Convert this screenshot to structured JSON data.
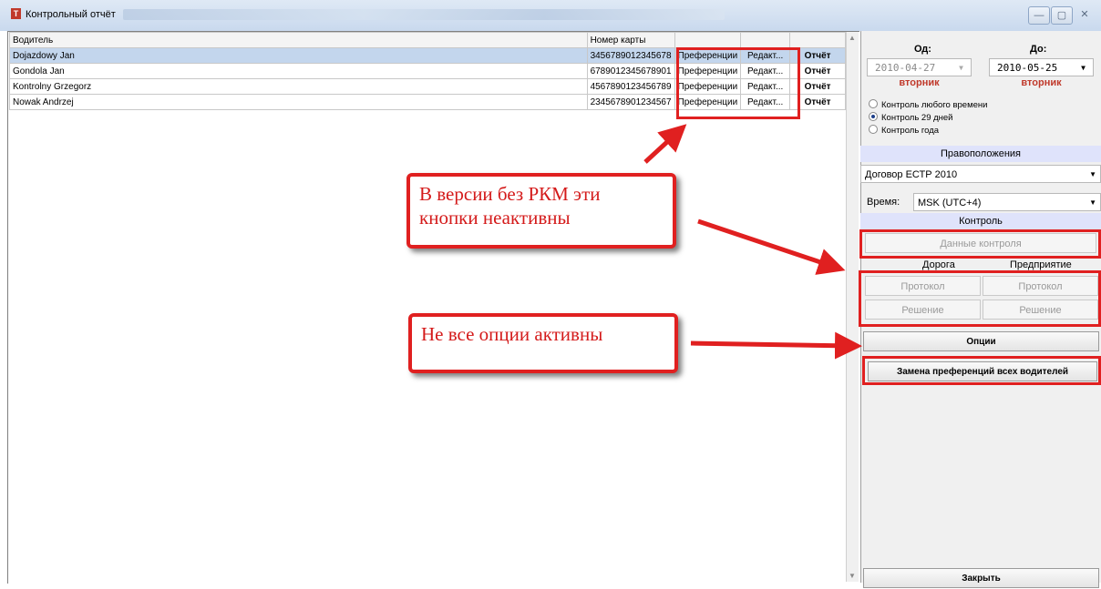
{
  "window": {
    "title": "Контрольный отчёт",
    "controls": [
      "—",
      "▢",
      "✕"
    ]
  },
  "table": {
    "headers": {
      "driver": "Водитель",
      "card": "Номер карты"
    },
    "rows": [
      {
        "driver": "Dojazdowy Jan",
        "card": "3456789012345678",
        "pref": "Преференции",
        "edit": "Редакт...",
        "report": "Отчёт"
      },
      {
        "driver": "Gondola Jan",
        "card": "6789012345678901",
        "pref": "Преференции",
        "edit": "Редакт...",
        "report": "Отчёт"
      },
      {
        "driver": "Kontrolny Grzegorz",
        "card": "4567890123456789",
        "pref": "Преференции",
        "edit": "Редакт...",
        "report": "Отчёт"
      },
      {
        "driver": "Nowak Andrzej",
        "card": "2345678901234567",
        "pref": "Преференции",
        "edit": "Редакт...",
        "report": "Отчёт"
      }
    ]
  },
  "panel": {
    "from_label": "Од:",
    "to_label": "До:",
    "from_date": "2010-04-27",
    "to_date": "2010-05-25",
    "from_day": "вторник",
    "to_day": "вторник",
    "radios": [
      {
        "label": "Контроль любого времени",
        "checked": false
      },
      {
        "label": "Контроль 29 дней",
        "checked": true
      },
      {
        "label": "Контроль года",
        "checked": false
      }
    ],
    "law_section": "Правоположения",
    "law_value": "Договор ЕСТР 2010",
    "time_label": "Время:",
    "time_value": "MSK (UTC+4)",
    "control_section": "Контроль",
    "control_data_btn": "Данные контроля",
    "road_label": "Дорога",
    "company_label": "Предприятие",
    "road_protocol": "Протокол",
    "company_protocol": "Протокол",
    "road_decision": "Решение",
    "company_decision": "Решение",
    "options_btn": "Опции",
    "replace_btn": "Замена преференций всех водителей",
    "close_btn": "Закрыть"
  },
  "annotations": {
    "callout1": "В версии без РКМ эти кнопки неактивны",
    "callout2": "Не все опции активны",
    "accent_color": "#e02020"
  }
}
